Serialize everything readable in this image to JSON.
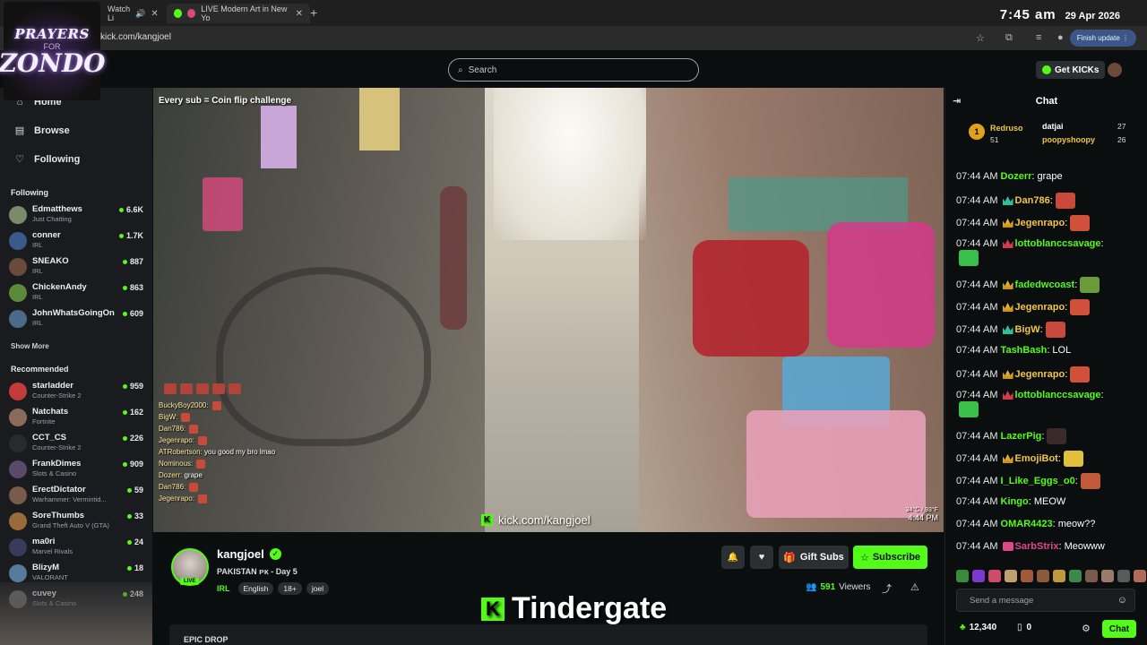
{
  "browser": {
    "tabs": [
      {
        "label": "Watch Li"
      },
      {
        "label": "LIVE Modern Art in New Yo"
      }
    ],
    "url": "kick.com/kangjoel",
    "finish_update": "Finish update"
  },
  "clock": {
    "time": "7:45 am",
    "date": "29 Apr 2026"
  },
  "logo": {
    "line1": "PRAYERS",
    "line2": "FOR",
    "line3": "ZONDO"
  },
  "topnav": {
    "search_placeholder": "Search",
    "get_kicks": "Get KICKs"
  },
  "sidebar": {
    "nav": [
      {
        "label": "Home",
        "icon": "home-icon"
      },
      {
        "label": "Browse",
        "icon": "browse-icon"
      },
      {
        "label": "Following",
        "icon": "heart-icon"
      }
    ],
    "following_title": "Following",
    "following": [
      {
        "name": "Edmatthews",
        "category": "Just Chatting",
        "viewers": "6.6K",
        "color": "#7a8a6a"
      },
      {
        "name": "conner",
        "category": "IRL",
        "viewers": "1.7K",
        "color": "#3a5a8a"
      },
      {
        "name": "SNEAKO",
        "category": "IRL",
        "viewers": "887",
        "color": "#6a4a3a"
      },
      {
        "name": "ChickenAndy",
        "category": "IRL",
        "viewers": "863",
        "color": "#5a8a3a"
      },
      {
        "name": "JohnWhatsGoingOn",
        "category": "IRL",
        "viewers": "609",
        "color": "#4a6a8a"
      }
    ],
    "show_more": "Show More",
    "recommended_title": "Recommended",
    "recommended": [
      {
        "name": "starladder",
        "category": "Counter-Strike 2",
        "viewers": "959",
        "color": "#c43a3a"
      },
      {
        "name": "Natchats",
        "category": "Fortnite",
        "viewers": "162",
        "color": "#8a6a5a"
      },
      {
        "name": "CCT_CS",
        "category": "Counter-Strike 2",
        "viewers": "226",
        "color": "#2a2a2a"
      },
      {
        "name": "FrankDimes",
        "category": "Slots & Casino",
        "viewers": "909",
        "color": "#5a4a6a"
      },
      {
        "name": "ErectDictator",
        "category": "Warhammer: Vermintid...",
        "viewers": "59",
        "color": "#7a5a4a"
      },
      {
        "name": "SoreThumbs",
        "category": "Grand Theft Auto V (GTA)",
        "viewers": "33",
        "color": "#9a6a3a"
      },
      {
        "name": "ma0ri",
        "category": "Marvel Rivals",
        "viewers": "24",
        "color": "#3a3a5a"
      },
      {
        "name": "BlizyM",
        "category": "VALORANT",
        "viewers": "18",
        "color": "#5a7a9a"
      },
      {
        "name": "cuvey",
        "category": "Slots & Casino",
        "viewers": "248",
        "color": "#6a6a6a"
      }
    ]
  },
  "video": {
    "sub_challenge": "Every sub = Coin flip challenge",
    "overlay_chat": [
      {
        "user": "BuckyBoy2000:",
        "text": ""
      },
      {
        "user": "BigW:",
        "text": ""
      },
      {
        "user": "Dan786:",
        "text": ""
      },
      {
        "user": "Jegenrapo:",
        "text": ""
      },
      {
        "user": "ATRobertson:",
        "text": "you good my bro lmao"
      },
      {
        "user": "Nominous:",
        "text": ""
      },
      {
        "user": "Dozerr:",
        "text": "grape"
      },
      {
        "user": "Dan786:",
        "text": ""
      },
      {
        "user": "Jegenrapo:",
        "text": ""
      }
    ],
    "watermark": "kick.com/kangjoel",
    "weather": "34°C / 93°F",
    "time": "4:44 PM"
  },
  "stream": {
    "streamer": "kangjoel",
    "live": "LIVE",
    "title": "PAKISTAN ᴘᴋ - Day 5",
    "category": "IRL",
    "tags": [
      "English",
      "18+",
      "joel"
    ],
    "gift_subs": "Gift Subs",
    "subscribe": "Subscribe",
    "viewers": "591",
    "viewers_label": "Viewers",
    "banner": "Tindergate",
    "about": "EPIC DROP"
  },
  "chat": {
    "title": "Chat",
    "leaderboard": {
      "first": {
        "rank": "1",
        "name": "Redruso",
        "count": "51"
      },
      "second": {
        "name": "datjai",
        "count": "27"
      },
      "third": {
        "name": "poopyshoopy",
        "count": "26"
      }
    },
    "messages": [
      {
        "time": "07:44 AM",
        "user": "Dozerr",
        "text": ": grape",
        "color": "#53fc18",
        "badge": "",
        "emote": ""
      },
      {
        "time": "07:44 AM",
        "user": "Dan786",
        "text": ":",
        "color": "#f4c542",
        "badge": "crown-g",
        "emote": "#c94a3a"
      },
      {
        "time": "07:44 AM",
        "user": "Jegenrapo",
        "text": ":",
        "color": "#f4c542",
        "badge": "crown",
        "emote": "#d0503a"
      },
      {
        "time": "07:44 AM",
        "user": "lottoblanccsavage",
        "text": ":",
        "color": "#53fc18",
        "badge": "crown-r",
        "emote": "#3abf4a",
        "tall": true
      },
      {
        "time": "07:44 AM",
        "user": "fadedwcoast",
        "text": ":",
        "color": "#53fc18",
        "badge": "crown",
        "emote": "#6a9a3a"
      },
      {
        "time": "07:44 AM",
        "user": "Jegenrapo",
        "text": ":",
        "color": "#f4c542",
        "badge": "crown",
        "emote": "#d0503a"
      },
      {
        "time": "07:44 AM",
        "user": "BigW",
        "text": ":",
        "color": "#f4c542",
        "badge": "crown-g",
        "emote": "#c94a3a"
      },
      {
        "time": "07:44 AM",
        "user": "TashBash",
        "text": ": LOL",
        "color": "#53fc18",
        "badge": "",
        "emote": ""
      },
      {
        "time": "07:44 AM",
        "user": "Jegenrapo",
        "text": ":",
        "color": "#f4c542",
        "badge": "crown",
        "emote": "#d0503a"
      },
      {
        "time": "07:44 AM",
        "user": "lottoblanccsavage",
        "text": ":",
        "color": "#53fc18",
        "badge": "crown-r",
        "emote": "#3abf4a",
        "tall": true
      },
      {
        "time": "07:44 AM",
        "user": "LazerPig",
        "text": ":",
        "color": "#53fc18",
        "badge": "",
        "emote": "#3a2a2a"
      },
      {
        "time": "07:44 AM",
        "user": "EmojiBot",
        "text": ":",
        "color": "#f4c542",
        "badge": "crown",
        "emote": "#e0c03a"
      },
      {
        "time": "07:44 AM",
        "user": "I_Like_Eggs_o0",
        "text": ":",
        "color": "#53fc18",
        "badge": "",
        "emote": "#c05a3a"
      },
      {
        "time": "07:44 AM",
        "user": "Kingo",
        "text": ": MEOW",
        "color": "#53fc18",
        "badge": "",
        "emote": ""
      },
      {
        "time": "07:44 AM",
        "user": "OMAR4423",
        "text": ": meow??",
        "color": "#53fc18",
        "badge": "",
        "emote": ""
      },
      {
        "time": "07:44 AM",
        "user": "SarbStrix",
        "text": ": Meowww",
        "color": "#e0468a",
        "badge": "gift",
        "emote": ""
      }
    ],
    "input_placeholder": "Send a message",
    "kicks": "12,340",
    "cards": "0",
    "chat_button": "Chat"
  }
}
